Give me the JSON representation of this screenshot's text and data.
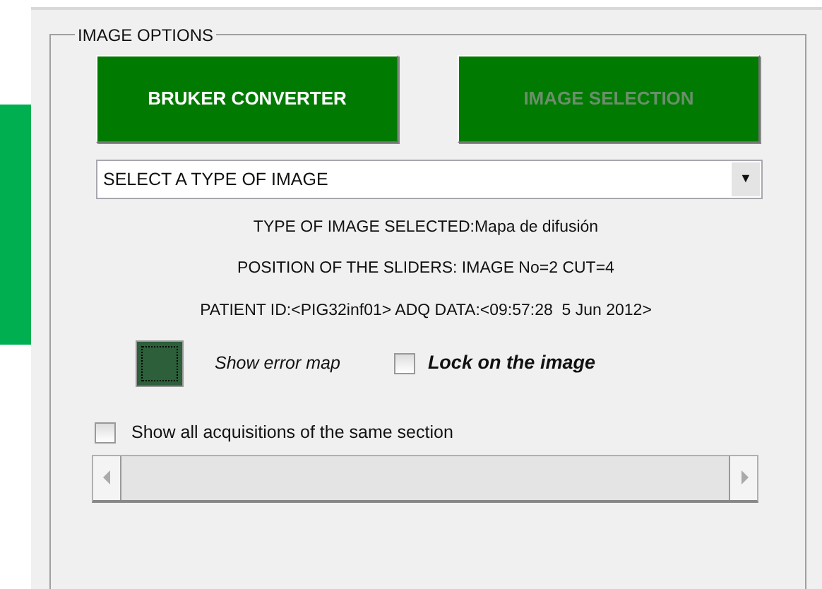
{
  "panel": {
    "title": "IMAGE OPTIONS"
  },
  "buttons": [
    {
      "label": "BRUKER CONVERTER",
      "disabled": false
    },
    {
      "label": "IMAGE SELECTION",
      "disabled": true
    }
  ],
  "dropdown": {
    "value": "SELECT A TYPE OF IMAGE",
    "arrow": "▼"
  },
  "info_lines": [
    "TYPE OF IMAGE SELECTED:Mapa de difusión",
    "POSITION OF THE SLIDERS: IMAGE No=2 CUT=4",
    "PATIENT ID:<PIG32inf01> ADQ DATA:<09:57:28  5 Jun 2012>"
  ],
  "error_map": {
    "label": "Show error map",
    "on": true
  },
  "lock_checkbox": {
    "label": "Lock on the image",
    "checked": false
  },
  "acquisitions_checkbox": {
    "label": "Show all acquisitions of the same section",
    "checked": false
  }
}
